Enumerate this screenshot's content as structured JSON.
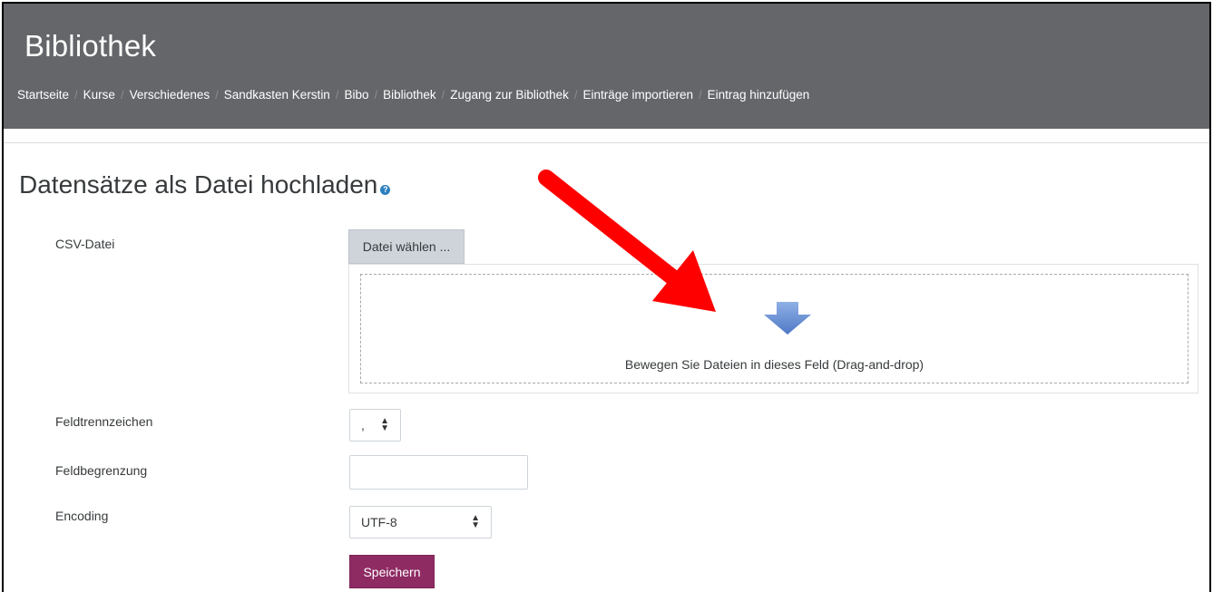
{
  "header": {
    "site_title": "Bibliothek",
    "breadcrumb": [
      "Startseite",
      "Kurse",
      "Verschiedenes",
      "Sandkasten Kerstin",
      "Bibo",
      "Bibliothek",
      "Zugang zur Bibliothek",
      "Einträge importieren",
      "Eintrag hinzufügen"
    ],
    "separator": "/"
  },
  "page": {
    "title": "Datensätze als Datei hochladen",
    "help_icon": "?"
  },
  "form": {
    "csv_label": "CSV-Datei",
    "file_button": "Datei wählen ...",
    "dropzone_text": "Bewegen Sie Dateien in dieses Feld (Drag-and-drop)",
    "delimiter_label": "Feldtrennzeichen",
    "delimiter_value": ",",
    "enclosure_label": "Feldbegrenzung",
    "enclosure_value": "",
    "encoding_label": "Encoding",
    "encoding_value": "UTF-8",
    "save_button": "Speichern"
  },
  "colors": {
    "header_bg": "#64666a",
    "save_button": "#8f2b63",
    "annotation_arrow": "#ff0000",
    "drop_arrow": "#5b86cf"
  },
  "icons": {
    "help": "help-icon",
    "drop": "arrow-down-icon",
    "annotation": "red-arrow-annotation",
    "select": "sort-arrows-icon"
  }
}
